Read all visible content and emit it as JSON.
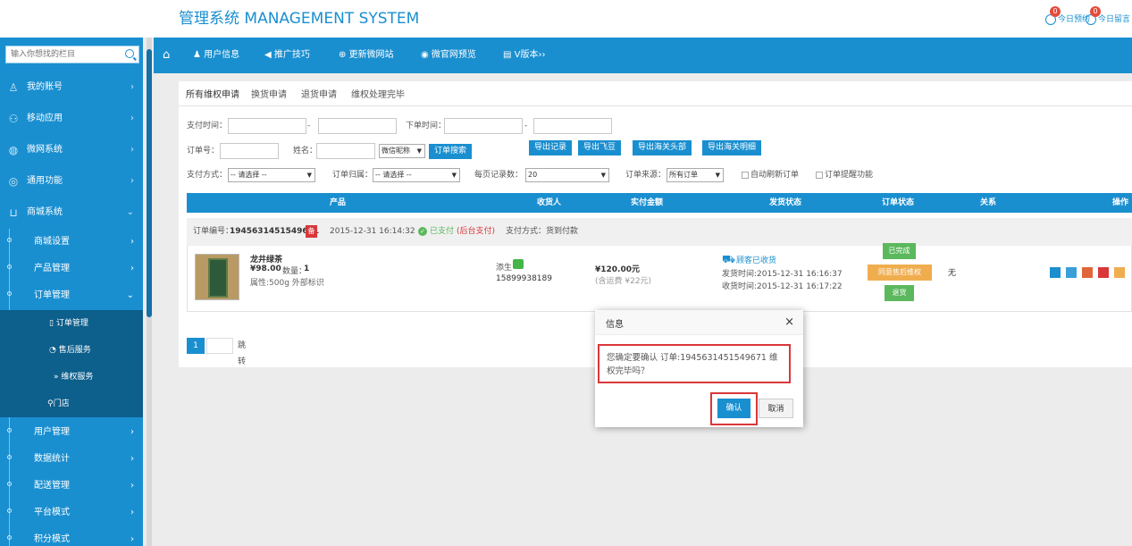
{
  "header": {
    "brand": "管理系统 MANAGEMENT SYSTEM",
    "appointment_count": "0",
    "appointment_label": "今日预约",
    "message_count": "0",
    "message_label": "今日留言"
  },
  "sidebar": {
    "search_placeholder": "输入你想找的栏目",
    "menu": [
      {
        "label": "我的账号",
        "icon": "user-icon"
      },
      {
        "label": "移动应用",
        "icon": "apps-icon"
      },
      {
        "label": "微网系统",
        "icon": "globe-icon"
      },
      {
        "label": "通用功能",
        "icon": "gear-icon"
      },
      {
        "label": "商城系统",
        "icon": "cart-icon"
      }
    ],
    "shop_subs": [
      "商城设置",
      "产品管理",
      "订单管理"
    ],
    "order_subs": [
      "订单管理",
      "售后服务",
      "维权服务",
      "门店"
    ],
    "after_subs": [
      "用户管理",
      "数据统计",
      "配送管理",
      "平台模式",
      "积分模式"
    ],
    "arrow": "›",
    "arrow_down": "⌄"
  },
  "topnav": {
    "items": [
      "用户信息",
      "推广技巧",
      "更新微网站",
      "微官网预览",
      "V版本"
    ],
    "suffix": "››"
  },
  "tabs": [
    "所有维权申请",
    "换货申请",
    "退货申请",
    "维权处理完毕"
  ],
  "filters": {
    "pay_time_label": "支付时间：",
    "dash": "-",
    "order_time_label": "下单时间：",
    "order_no_label": "订单号：",
    "name_label": "姓名：",
    "wechat_select": "微信昵称",
    "search_button": "订单搜索",
    "export_buttons": [
      "导出记录",
      "导出飞豆",
      "导出海关头部",
      "导出海关明细"
    ],
    "pay_method_label": "支付方式：",
    "pay_method_value": "-- 请选择 --",
    "order_belong_label": "订单归属：",
    "order_belong_value": "-- 请选择 --",
    "per_page_label": "每页记录数：",
    "per_page_value": "20",
    "source_label": "订单来源：",
    "source_value": "所有订单",
    "auto_refresh": "自动刷新订单",
    "remind": "订单提醒功能"
  },
  "table": {
    "headers": [
      "产品",
      "收货人",
      "实付金额",
      "发货状态",
      "订单状态",
      "关系",
      "操作"
    ]
  },
  "order": {
    "number_label": "订单编号：",
    "number": "1945631451549671",
    "badge": "备",
    "time": "2015-12-31 16:14:32",
    "paid": "已支付",
    "paid_note": "(后台支付)",
    "pay_method": "支付方式：货到付款",
    "product_name": "龙井绿茶",
    "price": "¥98.00",
    "qty_label": "数量：",
    "qty": "1",
    "attr": "属性:500g 外部标识",
    "receiver": "添生",
    "phone": "15899938189",
    "amount": "¥120.00元",
    "shipping": "(含运费 ¥22元)",
    "ship_status": "顾客已收货",
    "ship_time": "发货时间:2015-12-31 16:16:37",
    "recv_time": "收货时间:2015-12-31 16:17:22",
    "status_done": "已完成",
    "status_agree": "同意售后维权",
    "status_return": "退货",
    "relation": "无",
    "colors": {
      "done": "#5cb85c",
      "agree": "#f0ad4e",
      "return": "#5cb85c"
    }
  },
  "pager": {
    "current": "1",
    "jump": "跳转"
  },
  "dialog": {
    "title": "信息",
    "close": "×",
    "message": "您确定要确认 订单:1945631451549671 维权完毕吗？",
    "confirm": "确认",
    "cancel": "取消"
  }
}
